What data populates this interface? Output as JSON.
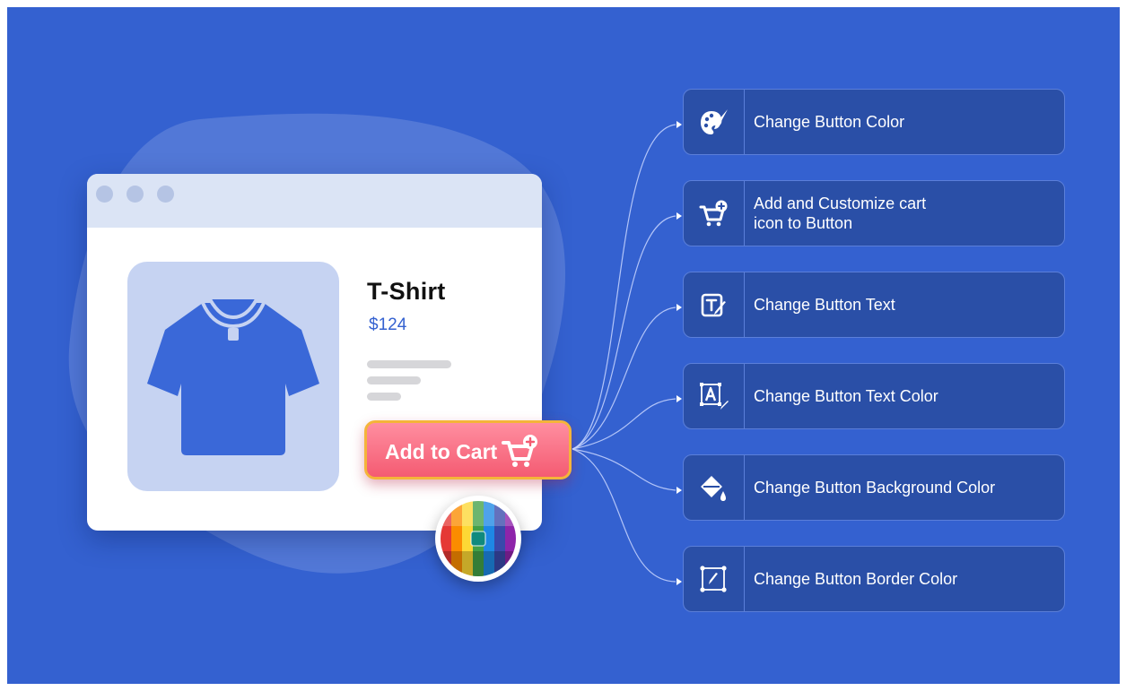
{
  "product": {
    "title": "T-Shirt",
    "price": "$124"
  },
  "cart_button": {
    "label": "Add to Cart",
    "icon": "cart-plus-icon"
  },
  "features": [
    {
      "label": "Change Button Color",
      "icon": "palette-brush-icon"
    },
    {
      "label": "Add and Customize cart\nicon to Button",
      "icon": "cart-plus-icon"
    },
    {
      "label": "Change Button Text",
      "icon": "text-edit-icon"
    },
    {
      "label": "Change Button Text Color",
      "icon": "text-color-icon"
    },
    {
      "label": "Change Button Background Color",
      "icon": "paint-bucket-icon"
    },
    {
      "label": "Change Button Border Color",
      "icon": "border-color-icon"
    }
  ],
  "colors": {
    "background": "#3461d0",
    "feature_box": "#2a4fa7",
    "button_gradient": [
      "#ff8ea0",
      "#f45b72"
    ],
    "button_border": "#f4b43a",
    "price": "#3461d0"
  }
}
